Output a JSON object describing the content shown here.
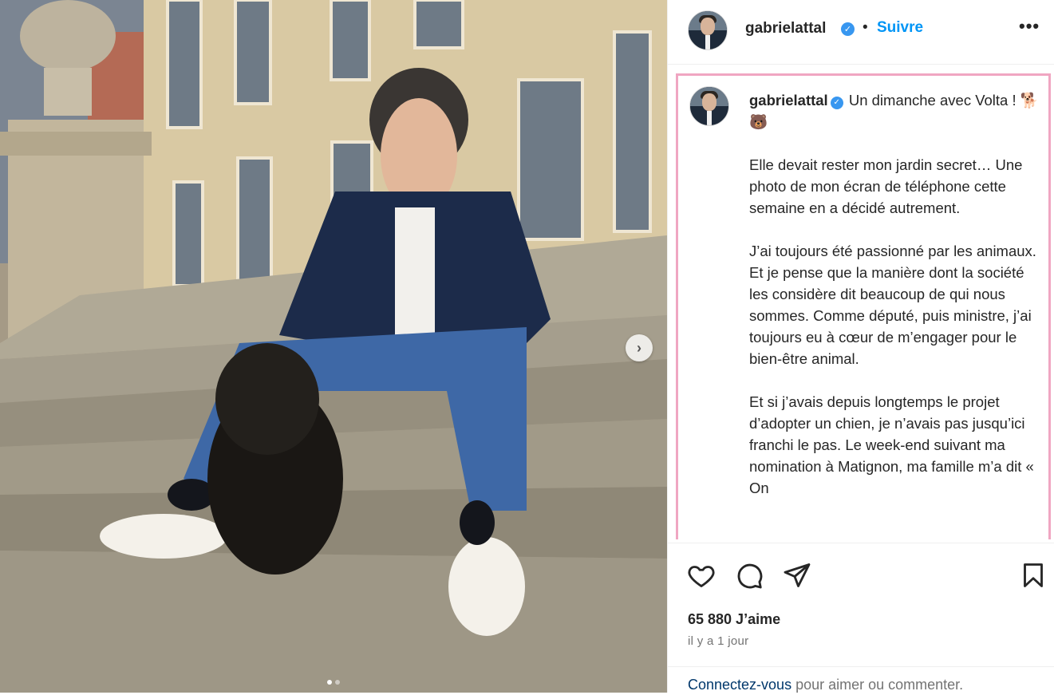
{
  "post": {
    "username": "gabrielattal",
    "separator": "•",
    "follow_label": "Suivre",
    "more_label": "•••",
    "next_label": "›"
  },
  "caption": {
    "username": "gabrielattal",
    "intro": "Un dimanche avec Volta ! 🐕🐻",
    "paragraphs": [
      "Elle devait rester mon jardin secret… Une photo de mon écran de téléphone cette semaine en a décidé autrement.",
      "J’ai toujours été passionné par les animaux. Et je pense que la manière dont la société les considère dit beaucoup de qui nous sommes. Comme député, puis ministre, j’ai toujours eu à cœur de m’engager pour le bien-être animal.",
      "Et si j’avais depuis longtemps le projet d’adopter un chien, je n’avais pas jusqu’ici franchi le pas. Le week-end suivant ma nomination à Matignon, ma famille m’a dit « On"
    ]
  },
  "actions": {
    "icons": [
      "heart-icon",
      "comment-icon",
      "share-icon",
      "bookmark-icon"
    ],
    "likes": "65 880 J’aime",
    "time_ago": "il y a 1 jour"
  },
  "login_prompt": {
    "link_text": "Connectez-vous",
    "rest_text": " pour aimer ou commenter."
  },
  "colors": {
    "accent": "#0095f6",
    "verified": "#3897f0",
    "caption_border": "#f0a6c2"
  }
}
